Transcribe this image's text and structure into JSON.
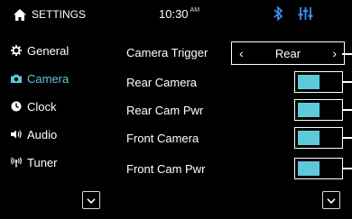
{
  "header": {
    "title": "SETTINGS",
    "time": "10:30",
    "ampm": "AM",
    "icons": [
      "home-icon",
      "bluetooth-icon",
      "equalizer-icon"
    ],
    "accent_color": "#5fc8da"
  },
  "sidebar": {
    "items": [
      {
        "label": "General",
        "icon": "gear-icon",
        "active": false
      },
      {
        "label": "Camera",
        "icon": "camera-icon",
        "active": true
      },
      {
        "label": "Clock",
        "icon": "clock-icon",
        "active": false
      },
      {
        "label": "Audio",
        "icon": "speaker-icon",
        "active": false
      },
      {
        "label": "Tuner",
        "icon": "antenna-icon",
        "active": false
      }
    ]
  },
  "settings": {
    "camera_trigger": {
      "label": "Camera Trigger",
      "value": "Rear"
    },
    "rows": [
      {
        "label": "Rear Camera",
        "enabled": true
      },
      {
        "label": "Rear Cam Pwr",
        "enabled": true
      },
      {
        "label": "Front Camera",
        "enabled": true
      },
      {
        "label": "Front Cam Pwr",
        "enabled": true
      }
    ]
  }
}
